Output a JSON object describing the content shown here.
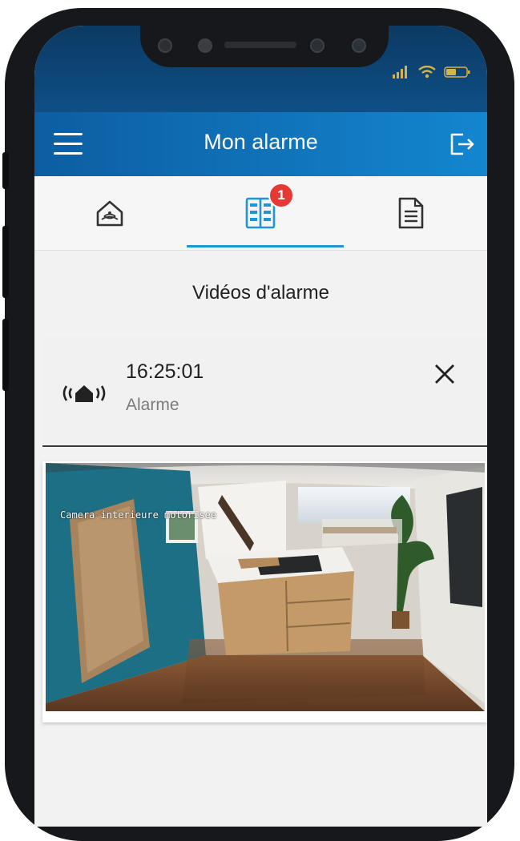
{
  "device": {
    "status_icons": [
      "signal-bars-icon",
      "wifi-icon",
      "battery-icon"
    ]
  },
  "header": {
    "title": "Mon alarme",
    "menu_icon": "hamburger-menu-icon",
    "logout_icon": "logout-icon"
  },
  "tabs": [
    {
      "name": "home",
      "icon": "house-icon",
      "active": false
    },
    {
      "name": "videos",
      "icon": "film-icon",
      "active": true,
      "badge": "1"
    },
    {
      "name": "documents",
      "icon": "document-icon",
      "active": false
    }
  ],
  "section": {
    "title": "Vidéos d'alarme"
  },
  "alarm": {
    "time": "16:25:01",
    "type": "Alarme",
    "icon": "house-alarm-icon",
    "close_icon": "close-icon"
  },
  "video": {
    "overlay_text": "Camera interieure motorisee"
  },
  "colors": {
    "status_bar": "#0b3a63",
    "app_bar": "#1386cf",
    "tab_accent": "#1e95d6",
    "badge": "#e53935",
    "background": "#f2f2f2"
  }
}
